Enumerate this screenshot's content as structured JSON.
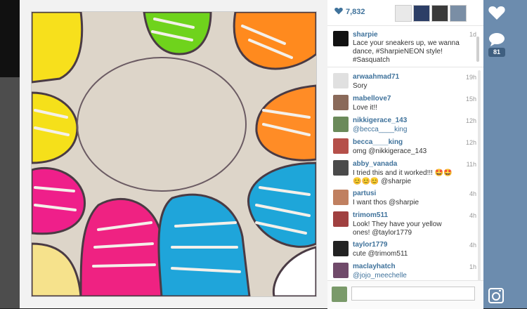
{
  "post": {
    "like_count": "7,832",
    "caption": {
      "username": "sharpie",
      "text": "Lace your sneakers up, we wanna dance, #SharpieNEON style! #Sasquatch",
      "time": "1d"
    }
  },
  "comments": [
    {
      "username": "arwaahmad71",
      "text": "Sory",
      "time": "19h"
    },
    {
      "username": "mabellove7",
      "text": "Love it!!",
      "time": "15h"
    },
    {
      "username": "nikkigerace_143",
      "text": "@becca____king",
      "time": "12h"
    },
    {
      "username": "becca____king",
      "text": "omg @nikkigerace_143",
      "time": "12h"
    },
    {
      "username": "abby_vanada",
      "text": "I tried this and it worked!!! 🤩🤩😊😊😊 @sharpie",
      "time": "11h"
    },
    {
      "username": "partusi",
      "text": "I want thos @sharpie",
      "time": "4h"
    },
    {
      "username": "trimom511",
      "text": "Look! They have your yellow ones! @taylor1779",
      "time": "4h"
    },
    {
      "username": "taylor1779",
      "text": "cute @trimom511",
      "time": "4h"
    },
    {
      "username": "maclayhatch",
      "text": "@jojo_meechelle",
      "time": "1h"
    }
  ],
  "footer": {
    "comment_placeholder": ""
  },
  "side_rail": {
    "comment_count": "81"
  },
  "colors": {
    "brand_blue": "#3f729b",
    "rail": "#6c8cae"
  },
  "icons": {
    "like": "heart-icon",
    "comment": "comment-bubble-icon",
    "camera": "instagram-camera-icon"
  }
}
